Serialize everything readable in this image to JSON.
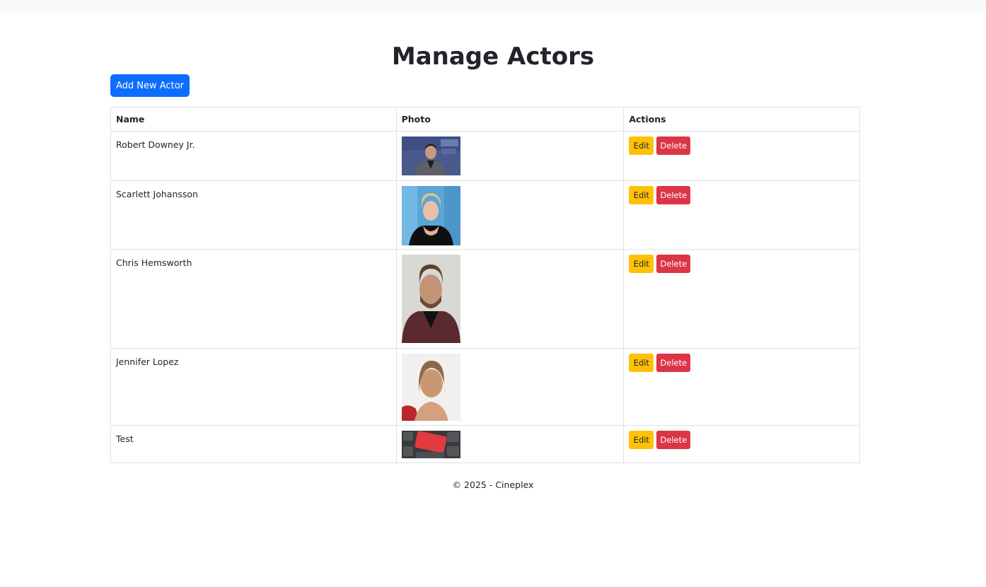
{
  "page": {
    "title": "Manage Actors",
    "add_button": "Add New Actor",
    "footer": "© 2025 - Cineplex"
  },
  "table": {
    "headers": [
      "Name",
      "Photo",
      "Actions"
    ],
    "rows": [
      {
        "name": "Robert Downey Jr.",
        "photo": "actor-photo-robert-downey-jr",
        "edit": "Edit",
        "delete": "Delete"
      },
      {
        "name": "Scarlett Johansson",
        "photo": "actor-photo-scarlett-johansson",
        "edit": "Edit",
        "delete": "Delete"
      },
      {
        "name": "Chris Hemsworth",
        "photo": "actor-photo-chris-hemsworth",
        "edit": "Edit",
        "delete": "Delete"
      },
      {
        "name": "Jennifer Lopez",
        "photo": "actor-photo-jennifer-lopez",
        "edit": "Edit",
        "delete": "Delete"
      },
      {
        "name": "Test",
        "photo": "test-keyboard-photo",
        "edit": "Edit",
        "delete": "Delete"
      }
    ]
  },
  "colors": {
    "primary": "#0d6efd",
    "warning": "#ffc107",
    "danger": "#dc3545"
  }
}
